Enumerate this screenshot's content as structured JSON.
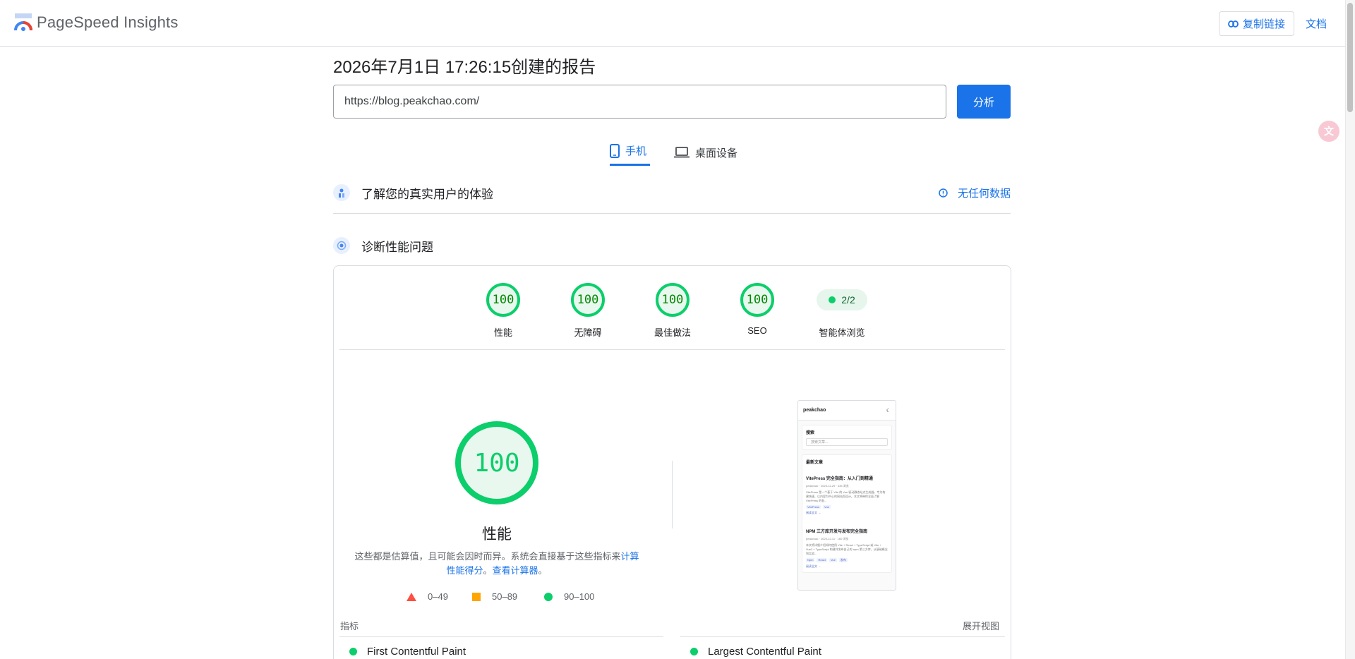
{
  "header": {
    "app_title": "PageSpeed Insights",
    "copy_link_label": "复制链接",
    "docs_label": "文档",
    "logo_icon": "pagespeed-logo-icon"
  },
  "report": {
    "title": "2026年7月1日 17:26:15创建的报告",
    "url_value": "https://blog.peakchao.com/",
    "analyze_label": "分析"
  },
  "tabs": [
    {
      "label": "手机",
      "icon": "mobile-icon",
      "active": true
    },
    {
      "label": "桌面设备",
      "icon": "laptop-icon",
      "active": false
    }
  ],
  "field_data": {
    "label": "了解您的真实用户的体验",
    "no_data_label": "无任何数据"
  },
  "lab_data": {
    "label": "诊断性能问题"
  },
  "scores": [
    {
      "value": "100",
      "label": "性能"
    },
    {
      "value": "100",
      "label": "无障碍"
    },
    {
      "value": "100",
      "label": "最佳做法"
    },
    {
      "value": "100",
      "label": "SEO"
    }
  ],
  "agent": {
    "value": "2/2",
    "label": "智能体浏览"
  },
  "performance": {
    "score": "100",
    "label": "性能",
    "disclaimer_text": "这些都是估算值，且可能会因时而异。系统会直接基于这些指标来",
    "calc_link": "计算性能得分",
    "disclaimer_sep": "。",
    "calculator_link": "查看计算器",
    "disclaimer_end": "。"
  },
  "legend": [
    {
      "range": "0–49"
    },
    {
      "range": "50–89"
    },
    {
      "range": "90–100"
    }
  ],
  "thumbnail": {
    "site_name": "peakchao",
    "search_title": "搜索",
    "search_placeholder": "搜索文章...",
    "latest_title": "最新文章",
    "post1_title": "VitePress 完全指南：从入门到精通",
    "post1_meta": "peakchao · 2025-12-29 · 435 浏览",
    "post1_excerpt": "VitePress 是一个基于 Vite 的 Vue 驱动静态站点生成器，专为构建快速、以内容为中心的网站而设计。本文将带你全面了解 VitePress 的各...",
    "post1_tags": [
      "VitePress",
      "Vue"
    ],
    "post2_title": "NPM 三方库开发与发布完全指南",
    "post2_meta": "peakchao · 2025-12-11 · 160 浏览",
    "post2_excerpt": "本文将详细介绍如何使用 Vite + React + TypeScript 或 Vite + Vue3 + TypeScript 构建并发布自己的 npm 第三方库，从基础概念到实战...",
    "post2_tags": [
      "Npm",
      "React",
      "Vue",
      "发布"
    ],
    "read_more": "阅读全文 →"
  },
  "metrics": {
    "section_label": "指标",
    "expand_label": "展开视图",
    "items": [
      {
        "name": "First Contentful Paint"
      },
      {
        "name": "Largest Contentful Paint"
      }
    ]
  },
  "colors": {
    "accent": "#1a73e8",
    "pass": "#0cce6b",
    "average": "#ffa400",
    "fail": "#ff4e42"
  }
}
